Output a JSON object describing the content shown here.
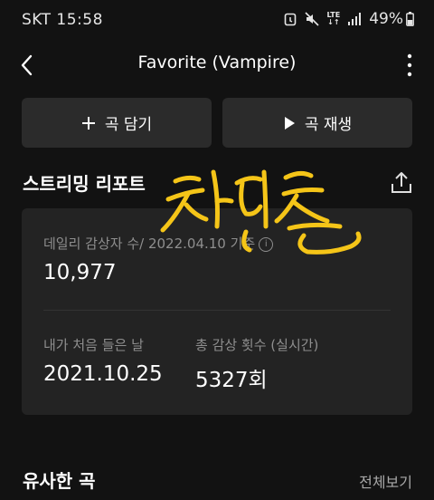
{
  "status_bar": {
    "carrier": "SKT",
    "time": "15:58",
    "network_label_top": "LTE",
    "network_label_bottom": "↓↑",
    "battery": "49%"
  },
  "header": {
    "title": "Favorite (Vampire)"
  },
  "actions": {
    "add_label": "곡 담기",
    "play_label": "곡 재생"
  },
  "report": {
    "title": "스트리밍 리포트",
    "daily_label": "데일리 감상자 수/ 2022.04.10 기준",
    "daily_value": "10,977",
    "first_listen_label": "내가 처음 들은 날",
    "first_listen_value": "2021.10.25",
    "total_plays_label": "총 감상 횟수 (실시간)",
    "total_plays_value": "5327회"
  },
  "similar": {
    "title": "유사한 곡",
    "view_all": "전체보기"
  },
  "colors": {
    "background": "#121212",
    "button": "#2b2b2b",
    "card": "#232323",
    "signature": "#f5c518",
    "muted_text": "#8e8e8e"
  }
}
